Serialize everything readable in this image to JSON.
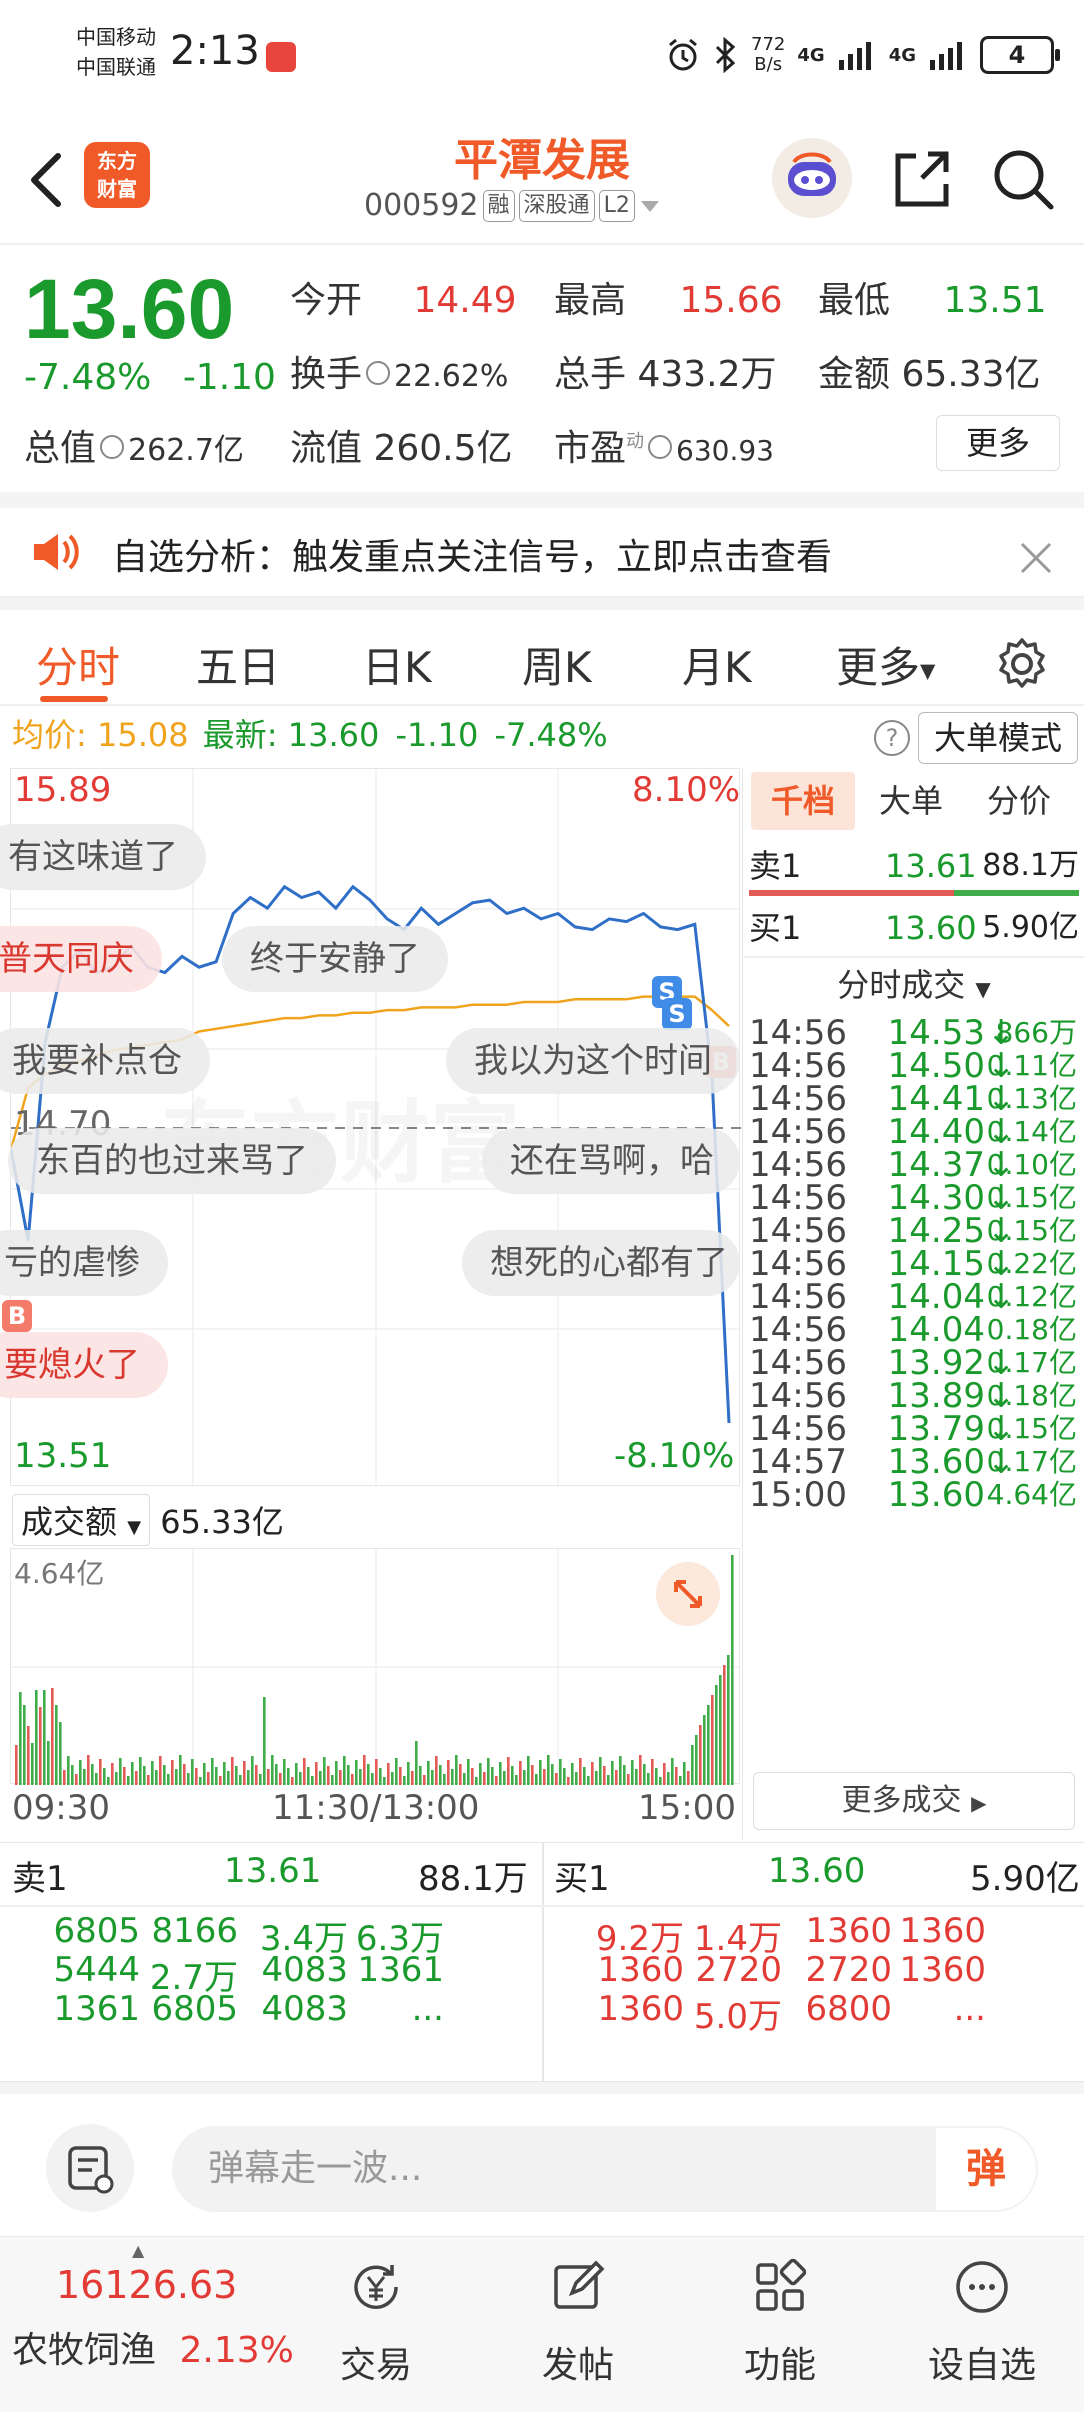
{
  "status_bar": {
    "carrier1": "中国移动",
    "carrier2": "中国联通",
    "time": "2:13",
    "net_speed_value": "772",
    "net_speed_unit": "B/s",
    "signal1": "4G",
    "signal2": "4G",
    "battery": "4"
  },
  "header": {
    "logo_line1": "东方",
    "logo_line2": "财富",
    "stock_name": "平潭发展",
    "stock_code": "000592",
    "tag_margin": "融",
    "tag_connect": "深股通",
    "tag_level": "L2"
  },
  "quote": {
    "price": "13.60",
    "change_pct": "-7.48%",
    "change_amt": "-1.10",
    "open_label": "今开",
    "open_value": "14.49",
    "high_label": "最高",
    "high_value": "15.66",
    "low_label": "最低",
    "low_value": "13.51",
    "turnover_label": "换手",
    "turnover_value": "22.62%",
    "volume_label": "总手",
    "volume_value": "433.2万",
    "amount_label": "金额",
    "amount_value": "65.33亿",
    "mktcap_label": "总值",
    "mktcap_value": "262.7亿",
    "float_label": "流值",
    "float_value": "260.5亿",
    "pe_label": "市盈",
    "pe_sup": "动",
    "pe_value": "630.93",
    "more_button": "更多"
  },
  "notice": {
    "text": "自选分析：触发重点关注信号，立即点击查看"
  },
  "tabs": [
    "分时",
    "五日",
    "日K",
    "周K",
    "月K",
    "更多"
  ],
  "avg_bar": {
    "avg_label": "均价:",
    "avg_value": "15.08",
    "latest_label": "最新:",
    "latest_value": "13.60",
    "latest_change": "-1.10",
    "latest_pct": "-7.48%",
    "help": "?",
    "big_order_mode": "大单模式"
  },
  "chart_labels": {
    "top_price": "15.89",
    "top_pct": "8.10%",
    "bottom_price": "13.51",
    "bottom_pct": "-8.10%",
    "ref_price": "14.70",
    "marker_b": "B",
    "marker_s": "S",
    "watermark": "东方财富"
  },
  "danmaku": [
    "有这味道了",
    "普天同庆",
    "终于安静了",
    "我要补点仓",
    "我以为这个时间",
    "东百的也过来骂了",
    "还在骂啊，哈",
    "亏的虐惨",
    "想死的心都有了",
    "要熄火了"
  ],
  "volume": {
    "selector": "成交额",
    "total": "65.33亿",
    "max_label": "4.64亿",
    "time_start": "09:30",
    "time_mid": "11:30/13:00",
    "time_end": "15:00"
  },
  "chart_data": {
    "type": "line",
    "x_range": [
      "09:30",
      "15:00"
    ],
    "ylim": [
      13.51,
      15.89
    ],
    "ref_price": 14.7,
    "series": [
      {
        "name": "最新",
        "color": "#2f6fc8",
        "values": [
          14.62,
          14.28,
          15.02,
          15.3,
          15.36,
          15.28,
          15.3,
          15.38,
          15.3,
          15.28,
          15.34,
          15.3,
          15.32,
          15.5,
          15.56,
          15.52,
          15.6,
          15.56,
          15.58,
          15.52,
          15.6,
          15.55,
          15.48,
          15.44,
          15.52,
          15.46,
          15.5,
          15.54,
          15.55,
          15.5,
          15.52,
          15.48,
          15.5,
          15.45,
          15.44,
          15.48,
          15.47,
          15.5,
          15.45,
          15.44,
          15.46,
          14.9,
          13.6
        ]
      },
      {
        "name": "均价",
        "color": "#f0a41e",
        "values": [
          14.62,
          14.85,
          14.9,
          14.93,
          14.95,
          14.97,
          14.99,
          15.0,
          15.01,
          15.02,
          15.03,
          15.06,
          15.07,
          15.08,
          15.09,
          15.1,
          15.11,
          15.11,
          15.12,
          15.12,
          15.13,
          15.13,
          15.14,
          15.14,
          15.15,
          15.15,
          15.15,
          15.16,
          15.16,
          15.16,
          15.17,
          15.17,
          15.17,
          15.18,
          15.18,
          15.18,
          15.18,
          15.19,
          15.19,
          15.19,
          15.19,
          15.14,
          15.08
        ]
      }
    ]
  },
  "right_panel": {
    "tabs": [
      "千档",
      "大单",
      "分价"
    ],
    "sell1_label": "卖1",
    "sell1_price": "13.61",
    "sell1_vol": "88.1万",
    "buy1_label": "买1",
    "buy1_price": "13.60",
    "buy1_vol": "5.90亿",
    "trades_title": "分时成交",
    "trades": [
      {
        "time": "14:56",
        "price": "14.53",
        "arrow": "↓",
        "vol": "866万"
      },
      {
        "time": "14:56",
        "price": "14.50",
        "arrow": "↓",
        "vol": "0.11亿"
      },
      {
        "time": "14:56",
        "price": "14.41",
        "arrow": "↓",
        "vol": "0.13亿"
      },
      {
        "time": "14:56",
        "price": "14.40",
        "arrow": "↓",
        "vol": "0.14亿"
      },
      {
        "time": "14:56",
        "price": "14.37",
        "arrow": "↓",
        "vol": "0.10亿"
      },
      {
        "time": "14:56",
        "price": "14.30",
        "arrow": "↓",
        "vol": "0.15亿"
      },
      {
        "time": "14:56",
        "price": "14.25",
        "arrow": "↓",
        "vol": "0.15亿"
      },
      {
        "time": "14:56",
        "price": "14.15",
        "arrow": "↓",
        "vol": "0.22亿"
      },
      {
        "time": "14:56",
        "price": "14.04",
        "arrow": "↓",
        "vol": "0.12亿"
      },
      {
        "time": "14:56",
        "price": "14.04",
        "arrow": "",
        "vol": "0.18亿"
      },
      {
        "time": "14:56",
        "price": "13.92",
        "arrow": "↓",
        "vol": "0.17亿"
      },
      {
        "time": "14:56",
        "price": "13.89",
        "arrow": "↓",
        "vol": "0.18亿"
      },
      {
        "time": "14:56",
        "price": "13.79",
        "arrow": "↓",
        "vol": "0.15亿"
      },
      {
        "time": "14:57",
        "price": "13.60",
        "arrow": "↓",
        "vol": "0.17亿"
      },
      {
        "time": "15:00",
        "price": "13.60",
        "arrow": "",
        "vol": "4.64亿"
      }
    ],
    "more_trades": "更多成交"
  },
  "order_book": {
    "sell_label": "卖1",
    "sell_price": "13.61",
    "sell_vol": "88.1万",
    "buy_label": "买1",
    "buy_price": "13.60",
    "buy_vol": "5.90亿",
    "sell_queue": [
      [
        "6805",
        "8166",
        "3.4万",
        "6.3万"
      ],
      [
        "5444",
        "2.7万",
        "4083",
        "1361"
      ],
      [
        "1361",
        "6805",
        "4083",
        "..."
      ]
    ],
    "buy_queue": [
      [
        "9.2万",
        "1.4万",
        "1360",
        "1360"
      ],
      [
        "1360",
        "2720",
        "2720",
        "1360"
      ],
      [
        "1360",
        "5.0万",
        "6800",
        "..."
      ]
    ]
  },
  "input_bar": {
    "placeholder": "弹幕走一波...",
    "send_label": "弹"
  },
  "bottom_nav": {
    "index_value": "16126.63",
    "index_name": "农牧饲渔",
    "index_pct": "2.13%",
    "items": [
      "交易",
      "发帖",
      "功能",
      "设自选"
    ]
  }
}
